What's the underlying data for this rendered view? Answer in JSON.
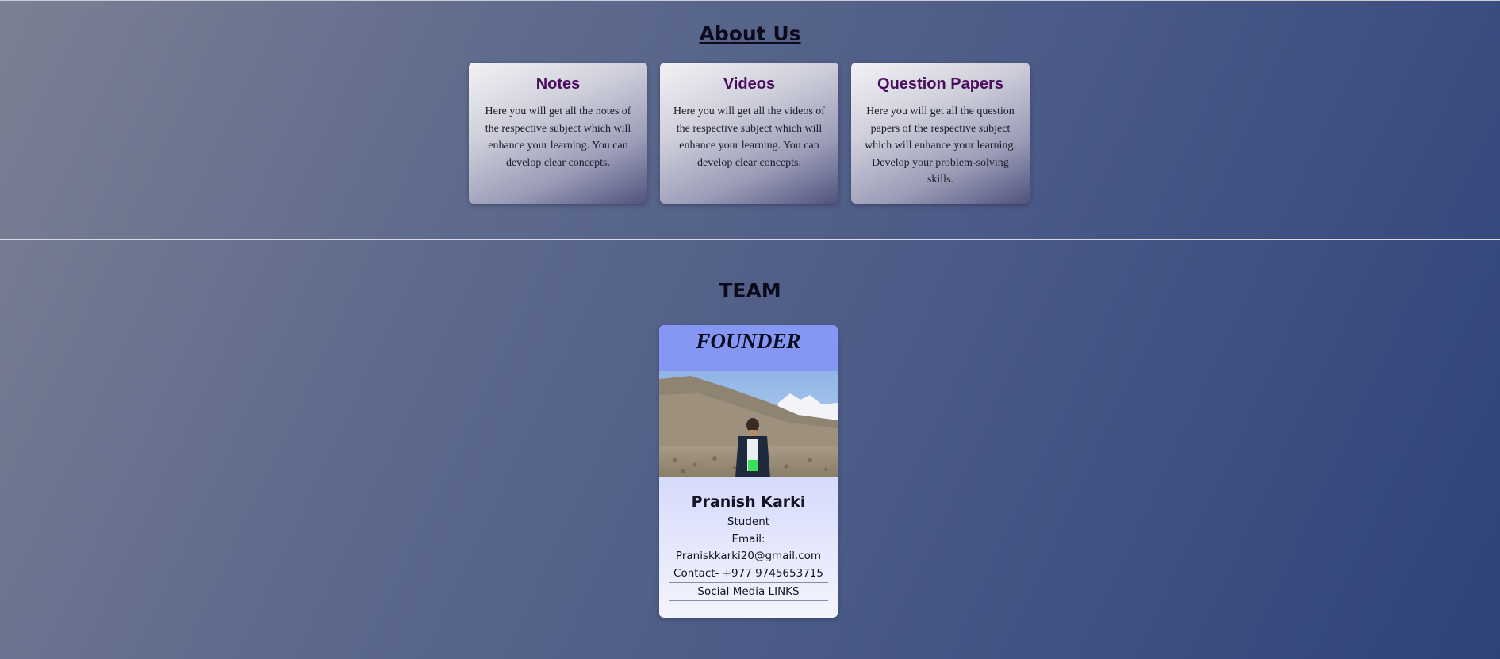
{
  "about": {
    "title": "About Us",
    "cards": [
      {
        "title": "Notes",
        "text": "Here you will get all the notes of the respective subject which will enhance your learning. You can develop clear concepts."
      },
      {
        "title": "Videos",
        "text": "Here you will get all the videos of the respective subject which will enhance your learning. You can develop clear concepts."
      },
      {
        "title": "Question Papers",
        "text": "Here you will get all the question papers of the respective subject which will enhance your learning. Develop your problem-solving skills."
      }
    ]
  },
  "team": {
    "title": "TEAM",
    "member": {
      "role": "FOUNDER",
      "name": "Pranish Karki",
      "occupation": "Student",
      "email_label": "Email:",
      "email": "Praniskkarki20@gmail.com",
      "contact": "Contact- +977 9745653715",
      "social": "Social Media LINKS"
    }
  },
  "colors": {
    "card_heading": "#4a0d5e",
    "founder_band": "#8597f3"
  }
}
